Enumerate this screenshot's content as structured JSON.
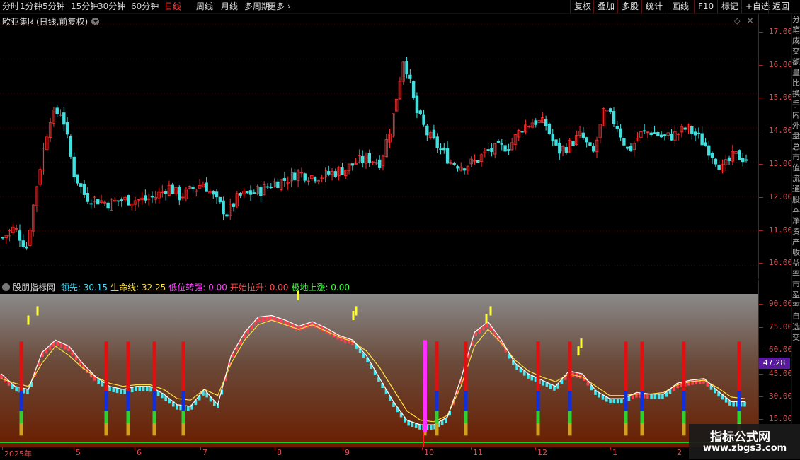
{
  "toolbar": {
    "periods": [
      "分时",
      "1分钟",
      "5分钟",
      "15分钟",
      "30分钟",
      "60分钟",
      "日线",
      "周线",
      "月线",
      "多周期",
      "更多"
    ],
    "more_glyph": "›",
    "active_period": "日线",
    "right_buttons": [
      "复权",
      "叠加",
      "多股",
      "统计",
      "画线",
      "F10",
      "标记",
      "+自选",
      "返回"
    ]
  },
  "main": {
    "title": "欧亚集团(日线,前复权)",
    "icons": [
      "diamond-icon",
      "close-icon"
    ],
    "price_axis": [
      "17.00",
      "16.00",
      "15.00",
      "14.00",
      "13.00",
      "12.00",
      "11.00",
      "10.00"
    ]
  },
  "indicator": {
    "name": "股朋指标网",
    "values": [
      {
        "label": "领先:",
        "value": "30.15",
        "color": "#40e0ff"
      },
      {
        "label": "生命线:",
        "value": "32.25",
        "color": "#ffe040"
      },
      {
        "label": "低位转强:",
        "value": "0.00",
        "color": "#ff40ff"
      },
      {
        "label": "开始拉升:",
        "value": "0.00",
        "color": "#ff5050"
      },
      {
        "label": "极地上涨:",
        "value": "0.00",
        "color": "#40ff40"
      }
    ],
    "axis": [
      "90.00",
      "75.00",
      "60.00",
      "45.00",
      "30.00",
      "15.00"
    ],
    "current_badge": "47.28"
  },
  "dates": [
    "2025年",
    "5",
    "6",
    "7",
    "8",
    "9",
    "10",
    "11",
    "12",
    "1",
    "2"
  ],
  "side_chars": [
    "分",
    "笔",
    "成",
    "交",
    "额",
    "量",
    "比",
    "换",
    "手",
    "内",
    "外",
    "盘",
    "总",
    "市",
    "值",
    "流",
    "通",
    "股",
    "本",
    "净",
    "资",
    "产",
    "收",
    "益",
    "率",
    "市",
    "盈",
    "率",
    "自",
    "选",
    "交"
  ],
  "watermark": {
    "title": "指标公式网",
    "url": "www.zbgs3.com"
  },
  "chart_data": {
    "type": "candlestick",
    "title": "欧亚集团(日线,前复权)",
    "ylim": [
      9.7,
      17.2
    ],
    "close_series_approx": [
      10.8,
      11.1,
      10.5,
      12.6,
      14.3,
      14.5,
      12.7,
      12.0,
      11.9,
      11.8,
      11.9,
      11.9,
      11.9,
      12.0,
      12.3,
      12.0,
      12.2,
      12.4,
      11.9,
      11.5,
      12.0,
      12.1,
      12.2,
      12.4,
      12.5,
      12.7,
      12.6,
      12.6,
      12.7,
      12.8,
      13.0,
      13.1,
      13.0,
      14.2,
      16.1,
      14.5,
      13.8,
      13.4,
      13.0,
      12.9,
      13.0,
      13.3,
      13.4,
      13.5,
      14.0,
      14.2,
      14.1,
      13.3,
      13.5,
      13.8,
      13.2,
      14.5,
      14.1,
      13.3,
      13.8,
      13.9,
      13.7,
      13.8,
      14.0,
      13.7,
      13.3,
      12.8,
      13.2,
      13.1
    ],
    "indicator": {
      "ylim": [
        10,
        100
      ],
      "series": [
        {
          "name": "领先",
          "values": [
            48,
            40,
            38,
            62,
            70,
            66,
            55,
            46,
            40,
            38,
            40,
            40,
            35,
            28,
            27,
            38,
            28,
            60,
            75,
            85,
            86,
            83,
            79,
            82,
            78,
            73,
            70,
            60,
            45,
            30,
            18,
            15,
            15,
            20,
            45,
            75,
            82,
            70,
            55,
            48,
            44,
            40,
            50,
            48,
            37,
            32,
            32,
            36,
            35,
            35,
            42,
            44,
            45,
            37,
            30,
            30
          ]
        },
        {
          "name": "生命线",
          "values": [
            45,
            42,
            40,
            55,
            66,
            60,
            52,
            46,
            42,
            40,
            41,
            41,
            38,
            32,
            31,
            38,
            34,
            55,
            70,
            80,
            83,
            80,
            77,
            80,
            76,
            72,
            69,
            63,
            52,
            38,
            24,
            18,
            17,
            21,
            40,
            66,
            77,
            68,
            57,
            50,
            46,
            43,
            48,
            46,
            40,
            34,
            34,
            35,
            35,
            36,
            41,
            43,
            44,
            39,
            33,
            32
          ]
        }
      ]
    }
  }
}
